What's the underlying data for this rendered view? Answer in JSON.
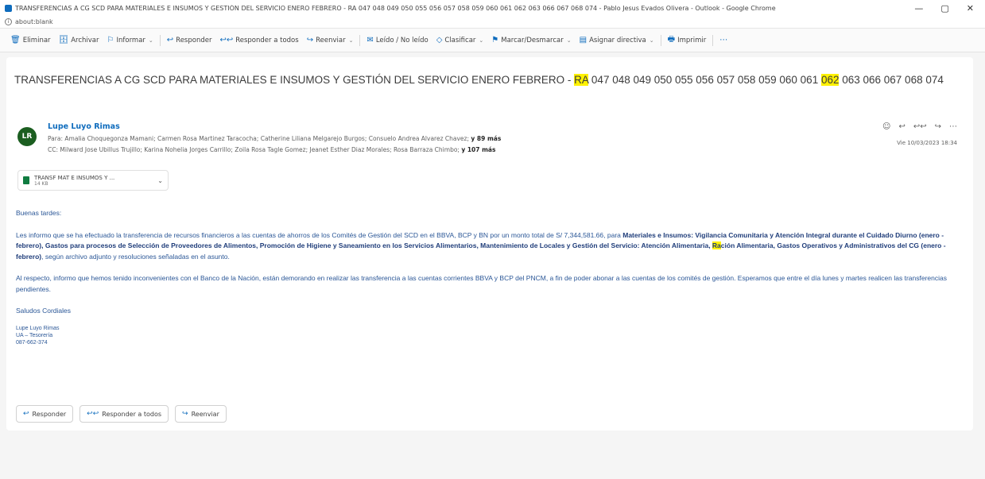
{
  "window": {
    "title": "TRANSFERENCIAS A CG SCD PARA MATERIALES E INSUMOS Y GESTIÓN DEL SERVICIO ENERO FEBRERO - RA 047 048 049 050 055 056 057 058 059 060 061 062 063 066 067 068 074 - Pablo Jesus Evados Olivera - Outlook - Google Chrome",
    "minimize": "—",
    "maximize": "▢",
    "close": "✕"
  },
  "url": "about:blank",
  "toolbar": {
    "items": [
      {
        "icon": "🗑",
        "label": "Eliminar"
      },
      {
        "icon": "🗄",
        "label": "Archivar"
      },
      {
        "icon": "⚐",
        "label": "Informar",
        "caret": "⌄"
      },
      {
        "icon": "↩",
        "label": "Responder"
      },
      {
        "icon": "↩↩",
        "label": "Responder a todos"
      },
      {
        "icon": "↪",
        "label": "Reenviar",
        "caret": "⌄"
      },
      {
        "icon": "✉",
        "label": "Leído / No leído"
      },
      {
        "icon": "◇",
        "label": "Clasificar",
        "caret": "⌄"
      },
      {
        "icon": "⚑",
        "label": "Marcar/Desmarcar",
        "caret": "⌄"
      },
      {
        "icon": "▤",
        "label": "Asignar directiva",
        "caret": "⌄"
      },
      {
        "icon": "🖶",
        "label": "Imprimir"
      },
      {
        "icon": "⋯",
        "label": ""
      }
    ]
  },
  "email": {
    "subject_pre": "TRANSFERENCIAS A CG SCD PARA MATERIALES E INSUMOS Y GESTIÓN DEL SERVICIO ENERO FEBRERO - ",
    "subject_hl1": "RA",
    "subject_mid": " 047 048 049 050 055 056 057 058 059 060 061 ",
    "subject_hl2": "062",
    "subject_post": " 063 066 067 068 074",
    "avatar_initials": "LR",
    "sender": "Lupe Luyo Rimas",
    "to_label": "Para:",
    "to_list": "Amalia Choquegonza Mamani; Carmen Rosa Martinez Taracocha; Catherine Liliana Melgarejo Burgos; Consuelo Andrea Alvarez Chavez;",
    "to_more": "y 89 más",
    "cc_label": "CC:",
    "cc_list": "Milward Jose Ubillus Trujillo; Karina Nohelia Jorges Carrillo; Zoila Rosa Tagle Gomez; Jeanet Esther Diaz Morales; Rosa Barraza Chimbo;",
    "cc_more": "y 107 más",
    "date": "Vie 10/03/2023 18:34",
    "attachment_name": "TRANSF MAT E INSUMOS Y ...",
    "attachment_size": "14 KB",
    "greeting": "Buenas tardes:",
    "p1_a": "Les informo que se ha efectuado la transferencia de recursos financieros a las cuentas de ahorros de los Comités de Gestión del SCD en el BBVA, BCP y BN por un monto total de S/ 7,344,581.66, para ",
    "p1_b1": "Materiales e Insumos: Vigilancia Comunitaria y Atención Integral durante el Cuidado Diurno (enero - febrero), Gastos para procesos de Selección de Proveedores de Alimentos, Promoción de Higiene y Saneamiento en los Servicios Alimentarios, Mantenimiento de Locales y Gestión del Servicio: Atención Alimentaria, ",
    "p1_hl": "Ra",
    "p1_b2": "ción Alimentaria, Gastos Operativos y Administrativos del CG (enero - febrero)",
    "p1_c": ", según archivo adjunto y resoluciones señaladas en el asunto.",
    "p2": "Al respecto, informo que hemos tenido inconvenientes con el Banco de la Nación, están demorando en realizar las transferencia a las cuentas corrientes BBVA y BCP del PNCM, a fin de poder abonar a las cuentas de los comités de gestión. Esperamos que entre el día lunes y martes realicen las transferencias pendientes.",
    "closing": "Saludos Cordiales",
    "sig_name": "Lupe Luyo Rimas",
    "sig_unit": "UA – Tesorería",
    "sig_ext": "087-662-374"
  },
  "header_actions": {
    "emoji": "☺",
    "reply": "↩",
    "reply_all": "↩↩",
    "forward": "↪",
    "more": "⋯"
  },
  "reply_buttons": {
    "reply": "Responder",
    "reply_all": "Responder a todos",
    "forward": "Reenviar"
  }
}
